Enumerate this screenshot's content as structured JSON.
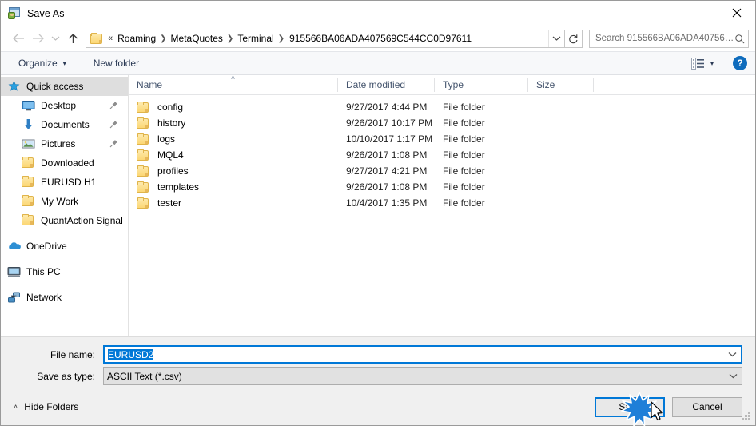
{
  "window": {
    "title": "Save As",
    "icon": "save-as-app-icon",
    "close_label": "✕"
  },
  "nav": {
    "back_icon": "arrow-left-icon",
    "forward_icon": "arrow-right-icon",
    "recent_icon": "chevron-down-icon",
    "up_icon": "arrow-up-icon",
    "breadcrumb_prefix": "«",
    "crumbs": [
      "Roaming",
      "MetaQuotes",
      "Terminal",
      "915566BA06ADA407569C544CC0D97611"
    ],
    "dropdown_icon": "chevron-down-icon",
    "refresh_icon": "refresh-icon",
    "search_placeholder": "Search 915566BA06ADA40756…",
    "search_icon": "search-icon"
  },
  "toolbar": {
    "organize_label": "Organize",
    "organize_caret": "▾",
    "new_folder_label": "New folder",
    "view_icon": "view-options-icon",
    "view_caret": "▾",
    "help_label": "?"
  },
  "sidebar": {
    "items": [
      {
        "label": "Quick access",
        "icon": "star-pin-icon",
        "level": 0,
        "selected": true,
        "pinned": false
      },
      {
        "label": "Desktop",
        "icon": "desktop-icon",
        "level": 1,
        "selected": false,
        "pinned": true
      },
      {
        "label": "Documents",
        "icon": "documents-icon",
        "level": 1,
        "selected": false,
        "pinned": true
      },
      {
        "label": "Pictures",
        "icon": "pictures-icon",
        "level": 1,
        "selected": false,
        "pinned": true
      },
      {
        "label": "Downloaded",
        "icon": "folder-icon",
        "level": 1,
        "selected": false,
        "pinned": false
      },
      {
        "label": "EURUSD H1",
        "icon": "folder-icon",
        "level": 1,
        "selected": false,
        "pinned": false
      },
      {
        "label": "My Work",
        "icon": "folder-icon",
        "level": 1,
        "selected": false,
        "pinned": false
      },
      {
        "label": "QuantAction Signal",
        "icon": "folder-icon",
        "level": 1,
        "selected": false,
        "pinned": false
      },
      {
        "label": "OneDrive",
        "icon": "onedrive-icon",
        "level": 0,
        "selected": false,
        "pinned": false,
        "group": true
      },
      {
        "label": "This PC",
        "icon": "this-pc-icon",
        "level": 0,
        "selected": false,
        "pinned": false,
        "group": true
      },
      {
        "label": "Network",
        "icon": "network-icon",
        "level": 0,
        "selected": false,
        "pinned": false,
        "group": true
      }
    ]
  },
  "filelist": {
    "headers": [
      "Name",
      "Date modified",
      "Type",
      "Size"
    ],
    "sort_column": "Name",
    "sort_indicator": "˄",
    "rows": [
      {
        "name": "config",
        "date": "9/27/2017 4:44 PM",
        "type": "File folder",
        "size": ""
      },
      {
        "name": "history",
        "date": "9/26/2017 10:17 PM",
        "type": "File folder",
        "size": ""
      },
      {
        "name": "logs",
        "date": "10/10/2017 1:17 PM",
        "type": "File folder",
        "size": ""
      },
      {
        "name": "MQL4",
        "date": "9/26/2017 1:08 PM",
        "type": "File folder",
        "size": ""
      },
      {
        "name": "profiles",
        "date": "9/27/2017 4:21 PM",
        "type": "File folder",
        "size": ""
      },
      {
        "name": "templates",
        "date": "9/26/2017 1:08 PM",
        "type": "File folder",
        "size": ""
      },
      {
        "name": "tester",
        "date": "10/4/2017 1:35 PM",
        "type": "File folder",
        "size": ""
      }
    ]
  },
  "form": {
    "filename_label": "File name:",
    "filename_value": "EURUSD2",
    "filetype_label": "Save as type:",
    "filetype_value": "ASCII Text (*.csv)",
    "caret_icon": "chevron-down-icon"
  },
  "footer": {
    "hide_folders_label": "Hide Folders",
    "hide_folders_caret": "˄",
    "save_label": "Save",
    "cancel_label": "Cancel",
    "resize_grip": "resize-grip-icon"
  },
  "colors": {
    "accent": "#0078d7",
    "folder_yellow": "#fcd775",
    "toolbar_bg": "#f7f8fa",
    "dialog_bg": "#f0f0f0",
    "header_text": "#44546d"
  }
}
